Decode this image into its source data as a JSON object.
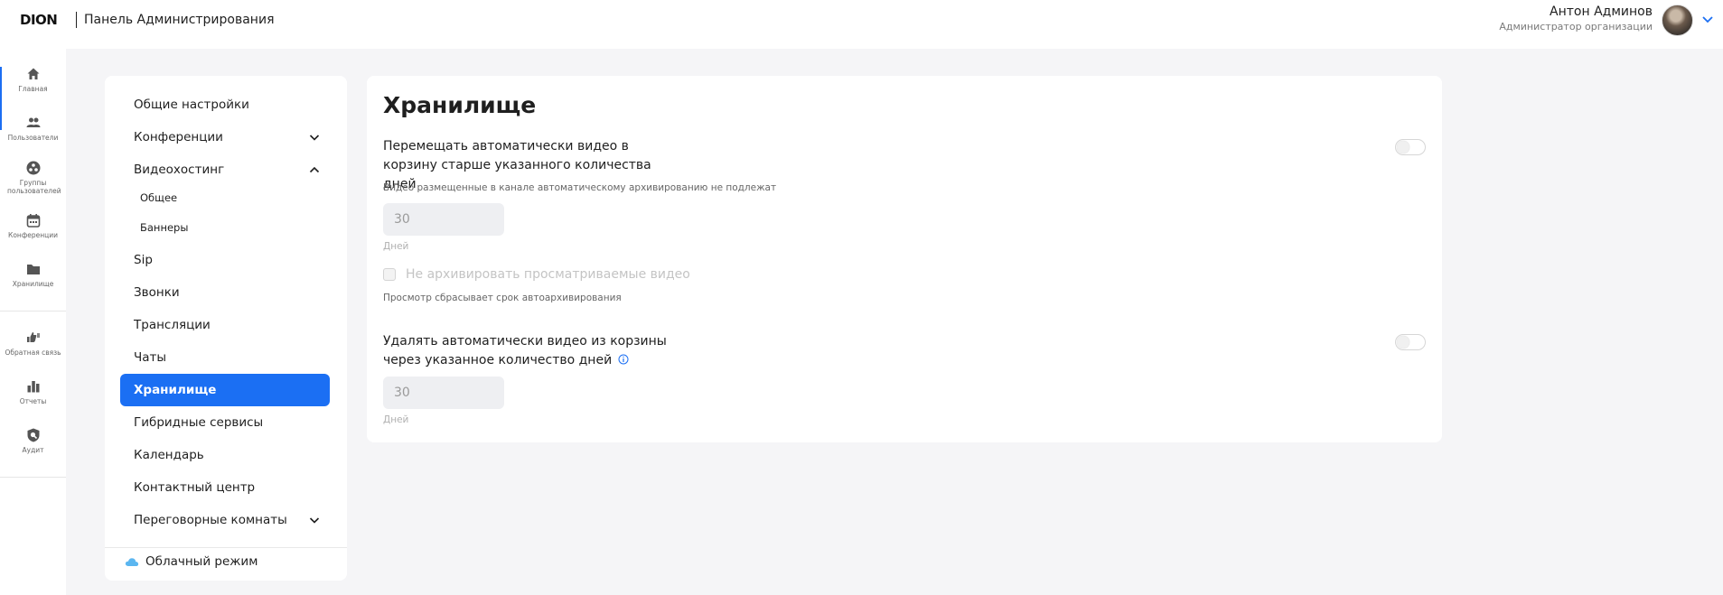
{
  "header": {
    "logo": "DION",
    "title": "Панель Администрирования",
    "user_name": "Антон Админов",
    "user_role": "Администратор организации"
  },
  "rail": {
    "items": [
      {
        "label": "Главная",
        "icon": "home-icon"
      },
      {
        "label": "Пользователи",
        "icon": "users-icon"
      },
      {
        "label": "Группы пользователей",
        "icon": "groups-icon"
      },
      {
        "label": "Конференции",
        "icon": "calendar-icon"
      },
      {
        "label": "Хранилище",
        "icon": "folder-icon"
      },
      {
        "label": "Обратная связь",
        "icon": "feedback-icon"
      },
      {
        "label": "Отчеты",
        "icon": "reports-icon"
      },
      {
        "label": "Аудит",
        "icon": "audit-icon"
      }
    ]
  },
  "nav": {
    "items": [
      {
        "label": "Общие настройки"
      },
      {
        "label": "Конференции",
        "chevron": "down"
      },
      {
        "label": "Видеохостинг",
        "chevron": "up"
      },
      {
        "label": "Общее",
        "sub": true
      },
      {
        "label": "Баннеры",
        "sub": true
      },
      {
        "label": "Sip"
      },
      {
        "label": "Звонки"
      },
      {
        "label": "Трансляции"
      },
      {
        "label": "Чаты"
      },
      {
        "label": "Хранилище",
        "active": true
      },
      {
        "label": "Гибридные сервисы"
      },
      {
        "label": "Календарь"
      },
      {
        "label": "Контактный центр"
      },
      {
        "label": "Переговорные комнаты",
        "chevron": "down"
      }
    ],
    "cloud_mode": "Облачный режим"
  },
  "content": {
    "title": "Хранилище",
    "option1": {
      "label": "Перемещать автоматически видео в корзину старше указанного количества дней",
      "hint": "Видео размещенные в канале автоматическому архивированию не подлежат",
      "value": "30",
      "unit": "Дней",
      "enabled": false
    },
    "checkbox": {
      "label": "Не архивировать просматриваемые видео",
      "hint": "Просмотр сбрасывает срок автоархивирования",
      "checked": false
    },
    "option2": {
      "label": "Удалять автоматически видео из корзины через указанное количество дней",
      "value": "30",
      "unit": "Дней",
      "enabled": false
    }
  },
  "colors": {
    "accent": "#1b6ff3",
    "background": "#f5f5f7"
  }
}
